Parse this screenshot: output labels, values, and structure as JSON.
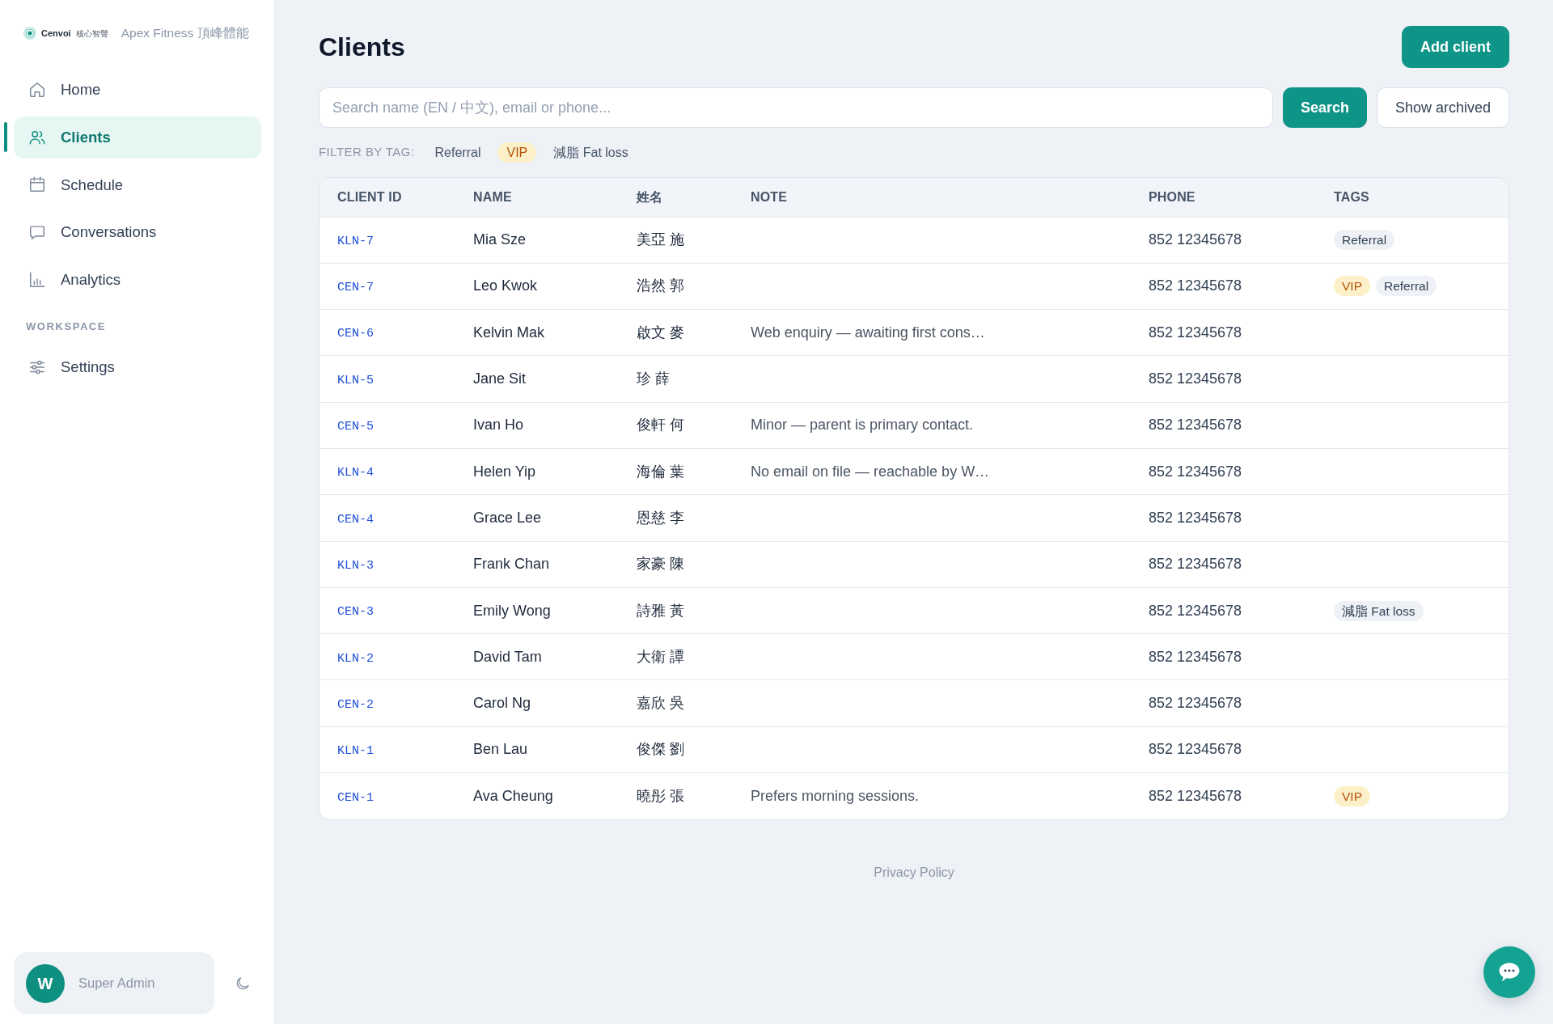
{
  "sidebar": {
    "brand": {
      "name": "Cenvoi",
      "name_zh": "核心智聲",
      "tenant": "Apex Fitness 頂峰體能"
    },
    "sections": [
      {
        "items": [
          {
            "label": "Home",
            "selected": false
          },
          {
            "label": "Clients",
            "selected": true
          },
          {
            "label": "Schedule",
            "selected": false
          },
          {
            "label": "Conversations",
            "selected": false
          },
          {
            "label": "Analytics",
            "selected": false
          }
        ]
      },
      {
        "title": "WORKSPACE",
        "items": [
          {
            "label": "Settings",
            "selected": false
          }
        ]
      }
    ],
    "user": {
      "initial": "W",
      "name": "Super Admin"
    }
  },
  "page": {
    "title": "Clients",
    "add_button": "Add client"
  },
  "search": {
    "placeholder": "Search name (EN / 中文), email or phone...",
    "button": "Search",
    "archived_button": "Show archived"
  },
  "filter": {
    "label": "FILTER BY TAG:",
    "tags": [
      {
        "label": "Referral",
        "kind": "neutral"
      },
      {
        "label": "VIP",
        "kind": "accent"
      },
      {
        "label": "減脂 Fat loss",
        "kind": "neutral"
      }
    ]
  },
  "table": {
    "columns": [
      "CLIENT ID",
      "NAME",
      "姓名",
      "NOTE",
      "PHONE",
      "TAGS"
    ],
    "rows": [
      {
        "id": "KLN-7",
        "name": "Mia Sze",
        "name_zh": "美亞 施",
        "phone": "852 12345678",
        "tags": [
          {
            "label": "Referral",
            "kind": "neutral"
          }
        ]
      },
      {
        "id": "CEN-7",
        "name": "Leo Kwok",
        "name_zh": "浩然 郭",
        "phone": "852 12345678",
        "tags": [
          {
            "label": "VIP",
            "kind": "accent"
          },
          {
            "label": "Referral",
            "kind": "neutral"
          }
        ]
      },
      {
        "id": "CEN-6",
        "name": "Kelvin Mak",
        "name_zh": "啟文 麥",
        "note": "Web enquiry — awaiting first cons…",
        "phone": "852 12345678"
      },
      {
        "id": "KLN-5",
        "name": "Jane Sit",
        "name_zh": "珍 薛",
        "phone": "852 12345678"
      },
      {
        "id": "CEN-5",
        "name": "Ivan Ho",
        "name_zh": "俊軒 何",
        "note": "Minor — parent is primary contact.",
        "phone": "852 12345678"
      },
      {
        "id": "KLN-4",
        "name": "Helen Yip",
        "name_zh": "海倫 葉",
        "note": "No email on file — reachable by W…",
        "phone": "852 12345678"
      },
      {
        "id": "CEN-4",
        "name": "Grace Lee",
        "name_zh": "恩慈 李",
        "phone": "852 12345678"
      },
      {
        "id": "KLN-3",
        "name": "Frank Chan",
        "name_zh": "家豪 陳",
        "phone": "852 12345678"
      },
      {
        "id": "CEN-3",
        "name": "Emily Wong",
        "name_zh": "詩雅 黃",
        "phone": "852 12345678",
        "tags": [
          {
            "label": "減脂 Fat loss",
            "kind": "neutral"
          }
        ]
      },
      {
        "id": "KLN-2",
        "name": "David Tam",
        "name_zh": "大衛 譚",
        "phone": "852 12345678"
      },
      {
        "id": "CEN-2",
        "name": "Carol Ng",
        "name_zh": "嘉欣 吳",
        "phone": "852 12345678"
      },
      {
        "id": "KLN-1",
        "name": "Ben Lau",
        "name_zh": "俊傑 劉",
        "phone": "852 12345678"
      },
      {
        "id": "CEN-1",
        "name": "Ava Cheung",
        "name_zh": "曉彤 張",
        "note": "Prefers morning sessions.",
        "phone": "852 12345678",
        "tags": [
          {
            "label": "VIP",
            "kind": "accent"
          }
        ]
      }
    ]
  },
  "footer": {
    "link": "Privacy Policy"
  }
}
